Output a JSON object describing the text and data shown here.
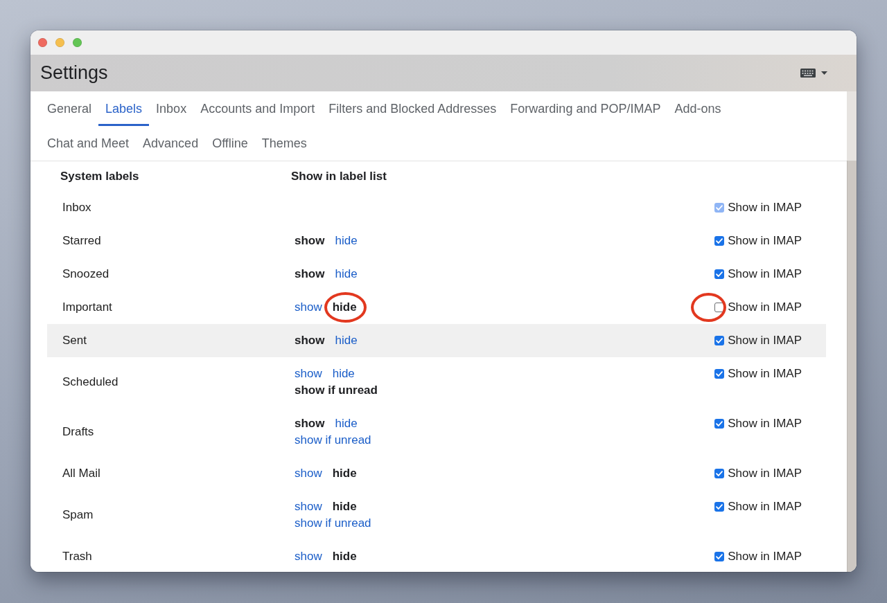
{
  "window": {
    "title": "Settings"
  },
  "tabs": [
    {
      "label": "General",
      "selected": false
    },
    {
      "label": "Labels",
      "selected": true
    },
    {
      "label": "Inbox",
      "selected": false
    },
    {
      "label": "Accounts and Import",
      "selected": false
    },
    {
      "label": "Filters and Blocked Addresses",
      "selected": false
    },
    {
      "label": "Forwarding and POP/IMAP",
      "selected": false
    },
    {
      "label": "Add-ons",
      "selected": false
    },
    {
      "label": "Chat and Meet",
      "selected": false
    },
    {
      "label": "Advanced",
      "selected": false
    },
    {
      "label": "Offline",
      "selected": false
    },
    {
      "label": "Themes",
      "selected": false
    }
  ],
  "table": {
    "columns": [
      "System labels",
      "Show in label list"
    ],
    "rows": [
      {
        "name": "Inbox",
        "hovered": false,
        "imap": {
          "label": "Show in IMAP",
          "checked": true,
          "disabled": true,
          "circled": false
        }
      },
      {
        "name": "Starred",
        "hovered": false,
        "options": [
          {
            "label": "show",
            "selected": true,
            "circled": false
          },
          {
            "label": "hide",
            "selected": false,
            "circled": false
          }
        ],
        "imap": {
          "label": "Show in IMAP",
          "checked": true,
          "disabled": false,
          "circled": false
        }
      },
      {
        "name": "Snoozed",
        "hovered": false,
        "options": [
          {
            "label": "show",
            "selected": true,
            "circled": false
          },
          {
            "label": "hide",
            "selected": false,
            "circled": false
          }
        ],
        "imap": {
          "label": "Show in IMAP",
          "checked": true,
          "disabled": false,
          "circled": false
        }
      },
      {
        "name": "Important",
        "hovered": false,
        "options": [
          {
            "label": "show",
            "selected": false,
            "circled": false
          },
          {
            "label": "hide",
            "selected": true,
            "circled": true
          }
        ],
        "imap": {
          "label": "Show in IMAP",
          "checked": false,
          "disabled": false,
          "circled": true
        }
      },
      {
        "name": "Sent",
        "hovered": true,
        "options": [
          {
            "label": "show",
            "selected": true,
            "circled": false
          },
          {
            "label": "hide",
            "selected": false,
            "circled": false
          }
        ],
        "imap": {
          "label": "Show in IMAP",
          "checked": true,
          "disabled": false,
          "circled": false
        }
      },
      {
        "name": "Scheduled",
        "hovered": false,
        "options": [
          {
            "label": "show",
            "selected": false,
            "circled": false
          },
          {
            "label": "hide",
            "selected": false,
            "circled": false
          },
          {
            "label": "show if unread",
            "selected": true,
            "circled": false
          }
        ],
        "imap": {
          "label": "Show in IMAP",
          "checked": true,
          "disabled": false,
          "circled": false
        }
      },
      {
        "name": "Drafts",
        "hovered": false,
        "options": [
          {
            "label": "show",
            "selected": true,
            "circled": false
          },
          {
            "label": "hide",
            "selected": false,
            "circled": false
          },
          {
            "label": "show if unread",
            "selected": false,
            "circled": false
          }
        ],
        "imap": {
          "label": "Show in IMAP",
          "checked": true,
          "disabled": false,
          "circled": false
        }
      },
      {
        "name": "All Mail",
        "hovered": false,
        "options": [
          {
            "label": "show",
            "selected": false,
            "circled": false
          },
          {
            "label": "hide",
            "selected": true,
            "circled": false
          }
        ],
        "imap": {
          "label": "Show in IMAP",
          "checked": true,
          "disabled": false,
          "circled": false
        }
      },
      {
        "name": "Spam",
        "hovered": false,
        "options": [
          {
            "label": "show",
            "selected": false,
            "circled": false
          },
          {
            "label": "hide",
            "selected": true,
            "circled": false
          },
          {
            "label": "show if unread",
            "selected": false,
            "circled": false
          }
        ],
        "imap": {
          "label": "Show in IMAP",
          "checked": true,
          "disabled": false,
          "circled": false
        }
      },
      {
        "name": "Trash",
        "hovered": false,
        "options": [
          {
            "label": "show",
            "selected": false,
            "circled": false
          },
          {
            "label": "hide",
            "selected": true,
            "circled": false
          }
        ],
        "imap": {
          "label": "Show in IMAP",
          "checked": true,
          "disabled": false,
          "circled": false
        }
      }
    ]
  }
}
